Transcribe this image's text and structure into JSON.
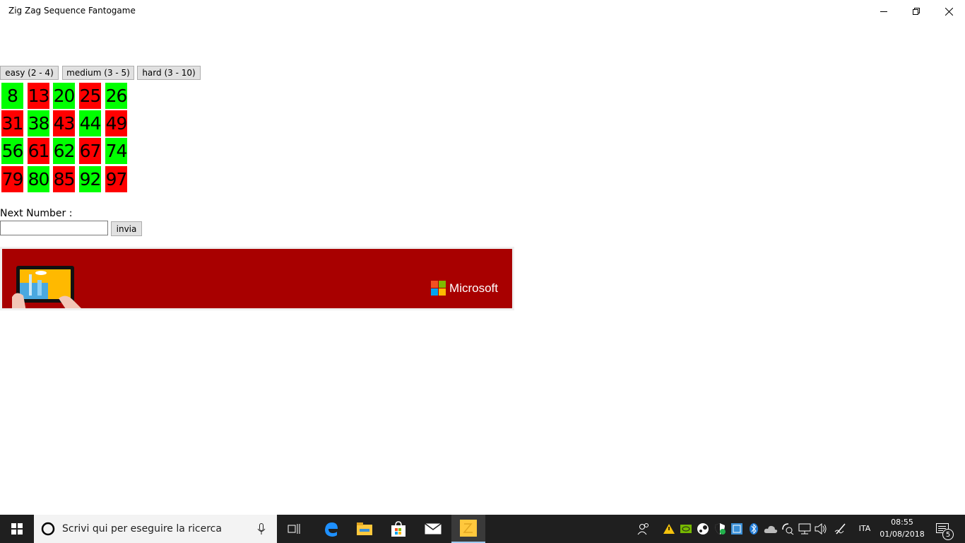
{
  "window": {
    "title": "Zig Zag Sequence Fantogame"
  },
  "difficulty": {
    "easy": "easy (2 - 4)",
    "medium": "medium (3 - 5)",
    "hard": "hard (3 - 10)"
  },
  "colors": {
    "green": "#00ff00",
    "red": "#ff0000",
    "ad_background": "#a80000"
  },
  "grid": {
    "rows": [
      [
        {
          "value": "8",
          "color": "green"
        },
        {
          "value": "13",
          "color": "red"
        },
        {
          "value": "20",
          "color": "green"
        },
        {
          "value": "25",
          "color": "red"
        },
        {
          "value": "26",
          "color": "green"
        }
      ],
      [
        {
          "value": "31",
          "color": "red"
        },
        {
          "value": "38",
          "color": "green"
        },
        {
          "value": "43",
          "color": "red"
        },
        {
          "value": "44",
          "color": "green"
        },
        {
          "value": "49",
          "color": "red"
        }
      ],
      [
        {
          "value": "56",
          "color": "green"
        },
        {
          "value": "61",
          "color": "red"
        },
        {
          "value": "62",
          "color": "green"
        },
        {
          "value": "67",
          "color": "red"
        },
        {
          "value": "74",
          "color": "green"
        }
      ],
      [
        {
          "value": "79",
          "color": "red"
        },
        {
          "value": "80",
          "color": "green"
        },
        {
          "value": "85",
          "color": "red"
        },
        {
          "value": "92",
          "color": "green"
        },
        {
          "value": "97",
          "color": "red"
        }
      ]
    ]
  },
  "next": {
    "label": "Next Number :",
    "value": "",
    "submit_label": "invia"
  },
  "ad": {
    "brand": "Microsoft"
  },
  "taskbar": {
    "search_placeholder": "Scrivi qui per eseguire la ricerca",
    "language": "ITA",
    "time": "08:55",
    "date": "01/08/2018",
    "notification_count": "5"
  }
}
